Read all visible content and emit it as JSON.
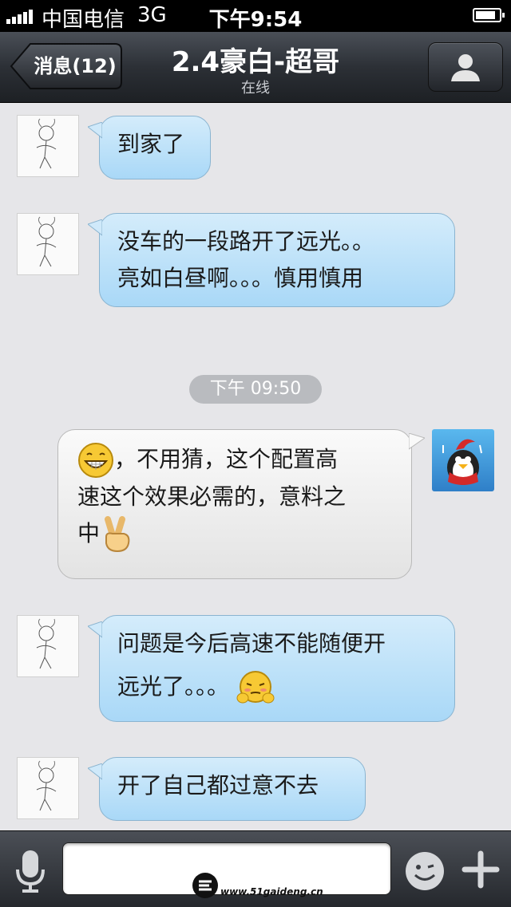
{
  "status_bar": {
    "carrier": "中国电信",
    "network": "3G",
    "time": "下午9:54",
    "icons": [
      "signal-icon",
      "battery-icon"
    ]
  },
  "nav": {
    "back_label": "消息(12)",
    "title": "2.4豪白-超哥",
    "subtitle": "在线",
    "profile_icon": "person-icon"
  },
  "messages": [
    {
      "side": "in",
      "text": "到家了"
    },
    {
      "side": "in",
      "lines": [
        "没车的一段路开了远光。。",
        "亮如白昼啊。。。慎用慎用"
      ]
    },
    {
      "side": "out",
      "parts": [
        "，不用猜，这个配置高",
        "速这个效果必需的，意料之",
        "中"
      ],
      "emoji": [
        "grin-emoji",
        "victory-hand-emoji"
      ]
    },
    {
      "side": "in",
      "lines": [
        "问题是今后高速不能随便开",
        "远光了。。。"
      ],
      "emoji": [
        "embarrassed-emoji"
      ]
    },
    {
      "side": "in",
      "text": "开了自己都过意不去"
    }
  ],
  "timestamp": "下午 09:50",
  "input_bar": {
    "placeholder": "",
    "icons": [
      "microphone-icon",
      "smiley-icon",
      "plus-icon"
    ]
  },
  "watermark": {
    "text": "www.51gaideng.cn"
  },
  "colors": {
    "incoming_bubble": "#b9dff8",
    "outgoing_bubble": "#eeeeee",
    "background": "#e6e6e9"
  }
}
